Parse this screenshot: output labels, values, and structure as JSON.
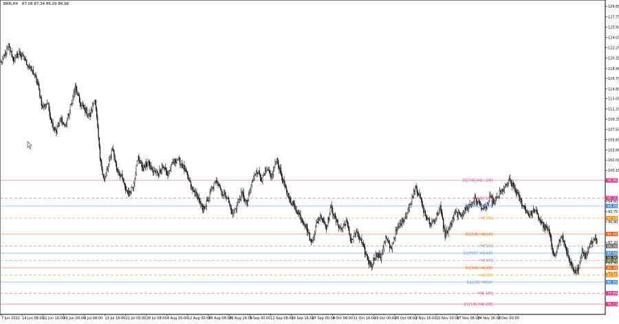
{
  "header": {
    "symbol": "BRN,H4",
    "ohlc": "87.08 87.34 86.09 86.96"
  },
  "chart_data": {
    "type": "candlestick",
    "symbol": "BRN",
    "timeframe": "H4",
    "ylim": [
      74.25,
      130.8
    ],
    "y_ticks": [
      "129.65",
      "127.75",
      "125.90",
      "124.05",
      "122.20",
      "120.35",
      "118.45",
      "116.70",
      "114.80",
      "113.05",
      "111.20",
      "109.35",
      "107.50",
      "105.65",
      "103.80",
      "102.00",
      "100.15",
      "98.30",
      "94.60",
      "92.75",
      "90.90",
      "87.20",
      "83.50",
      "81.65",
      "76.10"
    ],
    "x_labels": [
      "7 Jun 2022",
      "14 Jun 08:00",
      "21 Jun 16:00",
      "29 Jun 00:00",
      "6 Jul 08:00",
      "13 Jul 16:00",
      "21 Jul 00:00",
      "28 Jul 08:00",
      "4 Aug 16:00",
      "12 Aug 00:00",
      "19 Aug 08:00",
      "26 Aug 16:00",
      "5 Sep 00:00",
      "12 Sep 08:00",
      "19 Sep 16:00",
      "27 Sep 00:00",
      "4 Oct 08:00",
      "11 Oct 16:00",
      "19 Oct 00:00",
      "26 Oct 08:00",
      "2 Nov 16:00",
      "10 Nov 00:00",
      "17 Nov 08:00",
      "24 Nov 16:00",
      "2 Dec 00:00"
    ],
    "anchors": [
      {
        "t": 0,
        "p": 119.5
      },
      {
        "t": 4,
        "p": 120.6
      },
      {
        "t": 9,
        "p": 122.6
      },
      {
        "t": 15,
        "p": 120.0
      },
      {
        "t": 22,
        "p": 121.3
      },
      {
        "t": 28,
        "p": 120.2
      },
      {
        "t": 34,
        "p": 118.8
      },
      {
        "t": 40,
        "p": 117.5
      },
      {
        "t": 45,
        "p": 115.3
      },
      {
        "t": 50,
        "p": 111.5
      },
      {
        "t": 56,
        "p": 112.3
      },
      {
        "t": 62,
        "p": 108.5
      },
      {
        "t": 67,
        "p": 107.2
      },
      {
        "t": 72,
        "p": 109.5
      },
      {
        "t": 78,
        "p": 108.0
      },
      {
        "t": 84,
        "p": 111.5
      },
      {
        "t": 90,
        "p": 115.0
      },
      {
        "t": 96,
        "p": 112.0
      },
      {
        "t": 102,
        "p": 111.0
      },
      {
        "t": 108,
        "p": 110.0
      },
      {
        "t": 114,
        "p": 113.3
      },
      {
        "t": 120,
        "p": 102.0
      },
      {
        "t": 125,
        "p": 98.5
      },
      {
        "t": 130,
        "p": 101.0
      },
      {
        "t": 135,
        "p": 104.3
      },
      {
        "t": 140,
        "p": 100.5
      },
      {
        "t": 146,
        "p": 99.0
      },
      {
        "t": 150,
        "p": 97.0
      },
      {
        "t": 155,
        "p": 96.0
      },
      {
        "t": 160,
        "p": 97.5
      },
      {
        "t": 166,
        "p": 102.5
      },
      {
        "t": 172,
        "p": 100.5
      },
      {
        "t": 178,
        "p": 101.5
      },
      {
        "t": 184,
        "p": 100.0
      },
      {
        "t": 190,
        "p": 99.5
      },
      {
        "t": 196,
        "p": 101.0
      },
      {
        "t": 202,
        "p": 99.3
      },
      {
        "t": 208,
        "p": 101.5
      },
      {
        "t": 214,
        "p": 102.2
      },
      {
        "t": 220,
        "p": 101.0
      },
      {
        "t": 226,
        "p": 99.0
      },
      {
        "t": 232,
        "p": 96.5
      },
      {
        "t": 238,
        "p": 95.5
      },
      {
        "t": 244,
        "p": 93.0
      },
      {
        "t": 250,
        "p": 94.5
      },
      {
        "t": 256,
        "p": 97.0
      },
      {
        "t": 262,
        "p": 98.5
      },
      {
        "t": 268,
        "p": 96.0
      },
      {
        "t": 274,
        "p": 95.5
      },
      {
        "t": 280,
        "p": 92.2
      },
      {
        "t": 286,
        "p": 94.0
      },
      {
        "t": 292,
        "p": 96.0
      },
      {
        "t": 298,
        "p": 94.0
      },
      {
        "t": 304,
        "p": 98.0
      },
      {
        "t": 310,
        "p": 100.3
      },
      {
        "t": 316,
        "p": 98.5
      },
      {
        "t": 322,
        "p": 100.0
      },
      {
        "t": 328,
        "p": 99.0
      },
      {
        "t": 334,
        "p": 102.3
      },
      {
        "t": 340,
        "p": 99.0
      },
      {
        "t": 346,
        "p": 96.0
      },
      {
        "t": 352,
        "p": 94.5
      },
      {
        "t": 358,
        "p": 93.0
      },
      {
        "t": 364,
        "p": 91.5
      },
      {
        "t": 370,
        "p": 90.0
      },
      {
        "t": 376,
        "p": 87.0
      },
      {
        "t": 382,
        "p": 90.5
      },
      {
        "t": 388,
        "p": 92.0
      },
      {
        "t": 394,
        "p": 90.0
      },
      {
        "t": 400,
        "p": 93.5
      },
      {
        "t": 406,
        "p": 91.0
      },
      {
        "t": 412,
        "p": 89.5
      },
      {
        "t": 418,
        "p": 91.0
      },
      {
        "t": 424,
        "p": 87.5
      },
      {
        "t": 430,
        "p": 89.0
      },
      {
        "t": 436,
        "p": 87.5
      },
      {
        "t": 442,
        "p": 85.0
      },
      {
        "t": 448,
        "p": 83.0
      },
      {
        "t": 454,
        "p": 85.0
      },
      {
        "t": 460,
        "p": 84.5
      },
      {
        "t": 466,
        "p": 88.0
      },
      {
        "t": 472,
        "p": 86.0
      },
      {
        "t": 478,
        "p": 89.0
      },
      {
        "t": 484,
        "p": 90.5
      },
      {
        "t": 490,
        "p": 92.0
      },
      {
        "t": 496,
        "p": 94.0
      },
      {
        "t": 502,
        "p": 97.5
      },
      {
        "t": 508,
        "p": 95.0
      },
      {
        "t": 514,
        "p": 92.0
      },
      {
        "t": 520,
        "p": 90.5
      },
      {
        "t": 526,
        "p": 91.5
      },
      {
        "t": 532,
        "p": 93.5
      },
      {
        "t": 538,
        "p": 88.5
      },
      {
        "t": 544,
        "p": 90.0
      },
      {
        "t": 550,
        "p": 92.5
      },
      {
        "t": 556,
        "p": 92.0
      },
      {
        "t": 562,
        "p": 93.0
      },
      {
        "t": 568,
        "p": 94.0
      },
      {
        "t": 574,
        "p": 95.0
      },
      {
        "t": 580,
        "p": 94.0
      },
      {
        "t": 586,
        "p": 93.0
      },
      {
        "t": 592,
        "p": 95.0
      },
      {
        "t": 598,
        "p": 94.5
      },
      {
        "t": 604,
        "p": 96.0
      },
      {
        "t": 610,
        "p": 97.0
      },
      {
        "t": 616,
        "p": 98.3
      },
      {
        "t": 622,
        "p": 97.0
      },
      {
        "t": 628,
        "p": 95.0
      },
      {
        "t": 634,
        "p": 93.5
      },
      {
        "t": 640,
        "p": 92.0
      },
      {
        "t": 646,
        "p": 93.0
      },
      {
        "t": 652,
        "p": 91.5
      },
      {
        "t": 658,
        "p": 90.0
      },
      {
        "t": 664,
        "p": 89.0
      },
      {
        "t": 668,
        "p": 86.0
      },
      {
        "t": 672,
        "p": 85.0
      },
      {
        "t": 676,
        "p": 87.5
      },
      {
        "t": 680,
        "p": 88.0
      },
      {
        "t": 684,
        "p": 86.5
      },
      {
        "t": 688,
        "p": 84.0
      },
      {
        "t": 692,
        "p": 82.5
      },
      {
        "t": 696,
        "p": 81.5
      },
      {
        "t": 700,
        "p": 83.0
      },
      {
        "t": 704,
        "p": 86.0
      },
      {
        "t": 708,
        "p": 84.5
      },
      {
        "t": 712,
        "p": 86.5
      },
      {
        "t": 716,
        "p": 87.5
      },
      {
        "t": 720,
        "p": 88.0
      },
      {
        "t": 722,
        "p": 86.96
      }
    ],
    "levels": [
      {
        "price": 98.35,
        "label": "D1[7/8] H4[+2/8]",
        "color": "#e8308c",
        "dash": false
      },
      {
        "price": 95.15,
        "label": "H4[+1/8]",
        "color": "#e8308c",
        "dash": true
      },
      {
        "price": 93.75,
        "label": "D1[6/8] H4REB",
        "color": "#4a90e2",
        "dash": false
      },
      {
        "price": 91.55,
        "label": "H4[7/8]",
        "color": "#ff8c00",
        "dash": true
      },
      {
        "price": 88.7,
        "label": "D1[5/8] H4[6/8]",
        "color": "#ff5a00",
        "dash": false
      },
      {
        "price": 86.55,
        "label": "H4[5/8]",
        "color": "#888888",
        "dash": true
      },
      {
        "price": 85.25,
        "label": "D1PIVOT H4[4/8]",
        "color": "#4a90e2",
        "dash": false
      },
      {
        "price": 83.95,
        "label": "H4[3/8]",
        "color": "#888888",
        "dash": true
      },
      {
        "price": 82.65,
        "label": "D1[3/8] H4[2/8]",
        "color": "#ff5a00",
        "dash": false
      },
      {
        "price": 81.35,
        "label": "H4[1/8]",
        "color": "#ff8c00",
        "dash": true
      },
      {
        "price": 80.05,
        "label": "D1[2/8] H4SUP",
        "color": "#4a90e2",
        "dash": false
      },
      {
        "price": 78.05,
        "label": "H4[-1/8]",
        "color": "#e8308c",
        "dash": true
      },
      {
        "price": 76.1,
        "label": "D1[1/8] H4[-2/8]",
        "color": "#e8308c",
        "dash": false
      }
    ],
    "price_tags": [
      {
        "price": 98.35,
        "text": "96.86",
        "color": "#e8308c"
      },
      {
        "price": 95.15,
        "text": "95.31",
        "color": "#e8308c"
      },
      {
        "price": 93.75,
        "text": "93.75",
        "color": "#4a90e2"
      },
      {
        "price": 91.55,
        "text": "92.19",
        "color": "#ff8c00"
      },
      {
        "price": 88.7,
        "text": "89.06",
        "color": "#ff5a00"
      },
      {
        "price": 86.55,
        "text": "89.06",
        "color": "#666666"
      },
      {
        "price": 85.25,
        "text": "87.50",
        "color": "#4a90e2"
      },
      {
        "price": 84.4,
        "text": "86.96",
        "color": "#333333"
      },
      {
        "price": 83.95,
        "text": "85.94",
        "color": "#556b2f"
      },
      {
        "price": 82.65,
        "text": "84.38",
        "color": "#ff5a00"
      },
      {
        "price": 81.35,
        "text": "82.81",
        "color": "#ff8c00"
      },
      {
        "price": 80.05,
        "text": "81.25",
        "color": "#4a90e2"
      },
      {
        "price": 78.05,
        "text": "79.69",
        "color": "#e8308c"
      },
      {
        "price": 76.1,
        "text": "76.13",
        "color": "#e8308c"
      }
    ]
  }
}
